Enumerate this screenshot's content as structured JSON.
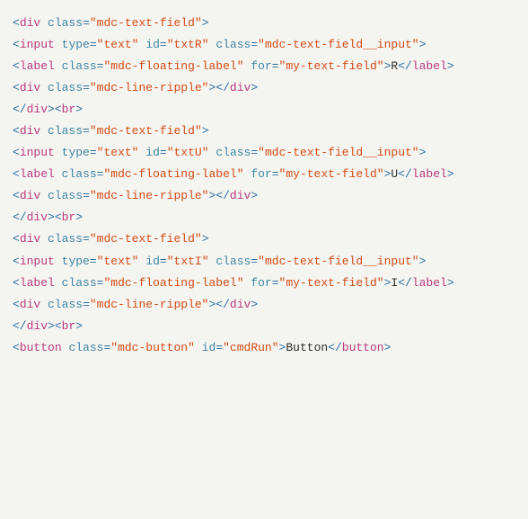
{
  "code_lines": [
    [
      {
        "cls": "p",
        "t": "<"
      },
      {
        "cls": "tg",
        "t": "div"
      },
      {
        "cls": "tx",
        "t": " "
      },
      {
        "cls": "an",
        "t": "class"
      },
      {
        "cls": "p",
        "t": "="
      },
      {
        "cls": "av",
        "t": "\"mdc-text-field\""
      },
      {
        "cls": "p",
        "t": ">"
      }
    ],
    [
      {
        "cls": "p",
        "t": "<"
      },
      {
        "cls": "tg",
        "t": "input"
      },
      {
        "cls": "tx",
        "t": " "
      },
      {
        "cls": "an",
        "t": "type"
      },
      {
        "cls": "p",
        "t": "="
      },
      {
        "cls": "av",
        "t": "\"text\""
      },
      {
        "cls": "tx",
        "t": " "
      },
      {
        "cls": "an",
        "t": "id"
      },
      {
        "cls": "p",
        "t": "="
      },
      {
        "cls": "av",
        "t": "\"txtR\""
      },
      {
        "cls": "tx",
        "t": " "
      },
      {
        "cls": "an",
        "t": "class"
      },
      {
        "cls": "p",
        "t": "="
      },
      {
        "cls": "av",
        "t": "\"mdc-text-field__input\""
      },
      {
        "cls": "p",
        "t": ">"
      }
    ],
    [
      {
        "cls": "p",
        "t": "<"
      },
      {
        "cls": "tg",
        "t": "label"
      },
      {
        "cls": "tx",
        "t": " "
      },
      {
        "cls": "an",
        "t": "class"
      },
      {
        "cls": "p",
        "t": "="
      },
      {
        "cls": "av",
        "t": "\"mdc-floating-label\""
      },
      {
        "cls": "tx",
        "t": " "
      },
      {
        "cls": "an",
        "t": "for"
      },
      {
        "cls": "p",
        "t": "="
      },
      {
        "cls": "av",
        "t": "\"my-text-field\""
      },
      {
        "cls": "p",
        "t": ">"
      },
      {
        "cls": "tx",
        "t": "R"
      },
      {
        "cls": "p",
        "t": "</"
      },
      {
        "cls": "tg",
        "t": "label"
      },
      {
        "cls": "p",
        "t": ">"
      }
    ],
    [
      {
        "cls": "p",
        "t": "<"
      },
      {
        "cls": "tg",
        "t": "div"
      },
      {
        "cls": "tx",
        "t": " "
      },
      {
        "cls": "an",
        "t": "class"
      },
      {
        "cls": "p",
        "t": "="
      },
      {
        "cls": "av",
        "t": "\"mdc-line-ripple\""
      },
      {
        "cls": "p",
        "t": ">"
      },
      {
        "cls": "p",
        "t": "</"
      },
      {
        "cls": "tg",
        "t": "div"
      },
      {
        "cls": "p",
        "t": ">"
      }
    ],
    [
      {
        "cls": "p",
        "t": "</"
      },
      {
        "cls": "tg",
        "t": "div"
      },
      {
        "cls": "p",
        "t": ">"
      },
      {
        "cls": "p",
        "t": "<"
      },
      {
        "cls": "tg",
        "t": "br"
      },
      {
        "cls": "p",
        "t": ">"
      }
    ],
    [
      {
        "cls": "p",
        "t": "<"
      },
      {
        "cls": "tg",
        "t": "div"
      },
      {
        "cls": "tx",
        "t": " "
      },
      {
        "cls": "an",
        "t": "class"
      },
      {
        "cls": "p",
        "t": "="
      },
      {
        "cls": "av",
        "t": "\"mdc-text-field\""
      },
      {
        "cls": "p",
        "t": ">"
      }
    ],
    [
      {
        "cls": "p",
        "t": "<"
      },
      {
        "cls": "tg",
        "t": "input"
      },
      {
        "cls": "tx",
        "t": " "
      },
      {
        "cls": "an",
        "t": "type"
      },
      {
        "cls": "p",
        "t": "="
      },
      {
        "cls": "av",
        "t": "\"text\""
      },
      {
        "cls": "tx",
        "t": " "
      },
      {
        "cls": "an",
        "t": "id"
      },
      {
        "cls": "p",
        "t": "="
      },
      {
        "cls": "av",
        "t": "\"txtU\""
      },
      {
        "cls": "tx",
        "t": " "
      },
      {
        "cls": "an",
        "t": "class"
      },
      {
        "cls": "p",
        "t": "="
      },
      {
        "cls": "av",
        "t": "\"mdc-text-field__input\""
      },
      {
        "cls": "p",
        "t": ">"
      }
    ],
    [
      {
        "cls": "p",
        "t": "<"
      },
      {
        "cls": "tg",
        "t": "label"
      },
      {
        "cls": "tx",
        "t": " "
      },
      {
        "cls": "an",
        "t": "class"
      },
      {
        "cls": "p",
        "t": "="
      },
      {
        "cls": "av",
        "t": "\"mdc-floating-label\""
      },
      {
        "cls": "tx",
        "t": " "
      },
      {
        "cls": "an",
        "t": "for"
      },
      {
        "cls": "p",
        "t": "="
      },
      {
        "cls": "av",
        "t": "\"my-text-field\""
      },
      {
        "cls": "p",
        "t": ">"
      },
      {
        "cls": "tx",
        "t": "U"
      },
      {
        "cls": "p",
        "t": "</"
      },
      {
        "cls": "tg",
        "t": "label"
      },
      {
        "cls": "p",
        "t": ">"
      }
    ],
    [
      {
        "cls": "p",
        "t": "<"
      },
      {
        "cls": "tg",
        "t": "div"
      },
      {
        "cls": "tx",
        "t": " "
      },
      {
        "cls": "an",
        "t": "class"
      },
      {
        "cls": "p",
        "t": "="
      },
      {
        "cls": "av",
        "t": "\"mdc-line-ripple\""
      },
      {
        "cls": "p",
        "t": ">"
      },
      {
        "cls": "p",
        "t": "</"
      },
      {
        "cls": "tg",
        "t": "div"
      },
      {
        "cls": "p",
        "t": ">"
      }
    ],
    [
      {
        "cls": "p",
        "t": "</"
      },
      {
        "cls": "tg",
        "t": "div"
      },
      {
        "cls": "p",
        "t": ">"
      },
      {
        "cls": "p",
        "t": "<"
      },
      {
        "cls": "tg",
        "t": "br"
      },
      {
        "cls": "p",
        "t": ">"
      }
    ],
    [
      {
        "cls": "p",
        "t": "<"
      },
      {
        "cls": "tg",
        "t": "div"
      },
      {
        "cls": "tx",
        "t": " "
      },
      {
        "cls": "an",
        "t": "class"
      },
      {
        "cls": "p",
        "t": "="
      },
      {
        "cls": "av",
        "t": "\"mdc-text-field\""
      },
      {
        "cls": "p",
        "t": ">"
      }
    ],
    [
      {
        "cls": "p",
        "t": "<"
      },
      {
        "cls": "tg",
        "t": "input"
      },
      {
        "cls": "tx",
        "t": " "
      },
      {
        "cls": "an",
        "t": "type"
      },
      {
        "cls": "p",
        "t": "="
      },
      {
        "cls": "av",
        "t": "\"text\""
      },
      {
        "cls": "tx",
        "t": " "
      },
      {
        "cls": "an",
        "t": "id"
      },
      {
        "cls": "p",
        "t": "="
      },
      {
        "cls": "av",
        "t": "\"txtI\""
      },
      {
        "cls": "tx",
        "t": " "
      },
      {
        "cls": "an",
        "t": "class"
      },
      {
        "cls": "p",
        "t": "="
      },
      {
        "cls": "av",
        "t": "\"mdc-text-field__input\""
      },
      {
        "cls": "p",
        "t": ">"
      }
    ],
    [
      {
        "cls": "p",
        "t": "<"
      },
      {
        "cls": "tg",
        "t": "label"
      },
      {
        "cls": "tx",
        "t": " "
      },
      {
        "cls": "an",
        "t": "class"
      },
      {
        "cls": "p",
        "t": "="
      },
      {
        "cls": "av",
        "t": "\"mdc-floating-label\""
      },
      {
        "cls": "tx",
        "t": " "
      },
      {
        "cls": "an",
        "t": "for"
      },
      {
        "cls": "p",
        "t": "="
      },
      {
        "cls": "av",
        "t": "\"my-text-field\""
      },
      {
        "cls": "p",
        "t": ">"
      },
      {
        "cls": "tx",
        "t": "I"
      },
      {
        "cls": "p",
        "t": "</"
      },
      {
        "cls": "tg",
        "t": "label"
      },
      {
        "cls": "p",
        "t": ">"
      }
    ],
    [
      {
        "cls": "p",
        "t": "<"
      },
      {
        "cls": "tg",
        "t": "div"
      },
      {
        "cls": "tx",
        "t": " "
      },
      {
        "cls": "an",
        "t": "class"
      },
      {
        "cls": "p",
        "t": "="
      },
      {
        "cls": "av",
        "t": "\"mdc-line-ripple\""
      },
      {
        "cls": "p",
        "t": ">"
      },
      {
        "cls": "p",
        "t": "</"
      },
      {
        "cls": "tg",
        "t": "div"
      },
      {
        "cls": "p",
        "t": ">"
      }
    ],
    [
      {
        "cls": "p",
        "t": "</"
      },
      {
        "cls": "tg",
        "t": "div"
      },
      {
        "cls": "p",
        "t": ">"
      },
      {
        "cls": "p",
        "t": "<"
      },
      {
        "cls": "tg",
        "t": "br"
      },
      {
        "cls": "p",
        "t": ">"
      }
    ],
    [
      {
        "cls": "p",
        "t": "<"
      },
      {
        "cls": "tg",
        "t": "button"
      },
      {
        "cls": "tx",
        "t": " "
      },
      {
        "cls": "an",
        "t": "class"
      },
      {
        "cls": "p",
        "t": "="
      },
      {
        "cls": "av",
        "t": "\"mdc-button\""
      },
      {
        "cls": "tx",
        "t": " "
      },
      {
        "cls": "an",
        "t": "id"
      },
      {
        "cls": "p",
        "t": "="
      },
      {
        "cls": "av",
        "t": "\"cmdRun\""
      },
      {
        "cls": "p",
        "t": ">"
      },
      {
        "cls": "tx",
        "t": "Button"
      },
      {
        "cls": "p",
        "t": "</"
      },
      {
        "cls": "tg",
        "t": "button"
      },
      {
        "cls": "p",
        "t": ">"
      }
    ]
  ]
}
